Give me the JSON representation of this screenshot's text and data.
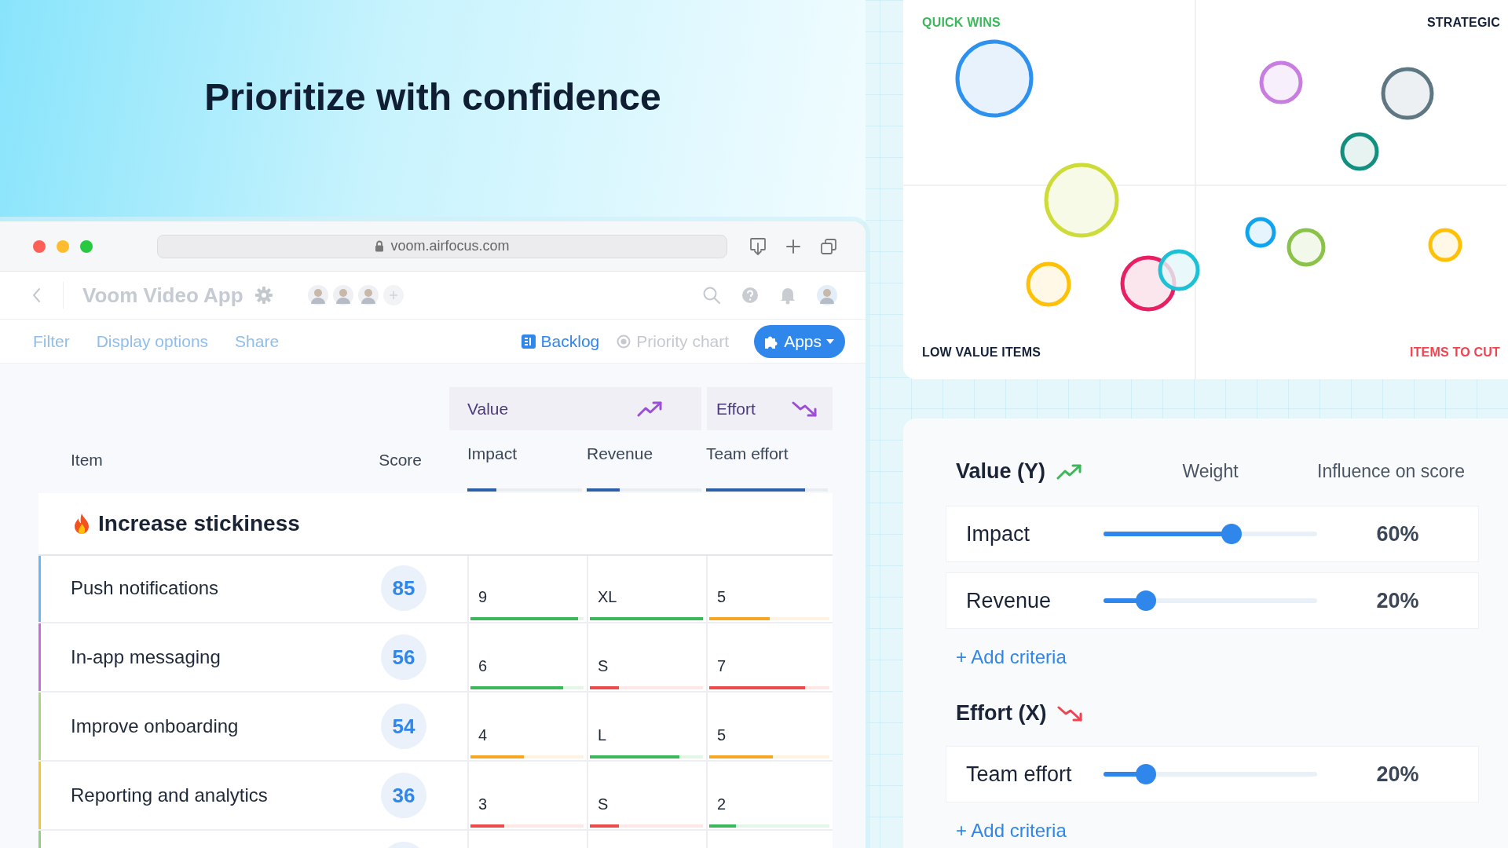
{
  "headline": "Prioritize with confidence",
  "browser": {
    "url": "voom.airfocus.com"
  },
  "app_header": {
    "title": "Voom Video App"
  },
  "toolbar": {
    "links": [
      "Filter",
      "Display options",
      "Share"
    ],
    "views": [
      {
        "label": "Backlog",
        "kind": "list",
        "selected": true
      },
      {
        "label": "Priority chart",
        "kind": "chart",
        "selected": false
      }
    ],
    "apps_button": "Apps"
  },
  "table": {
    "groups": [
      {
        "label": "Value",
        "kind": "up"
      },
      {
        "label": "Effort",
        "kind": "down"
      }
    ],
    "columns": [
      {
        "label": "Item"
      },
      {
        "label": "Score"
      },
      {
        "label": "Impact",
        "level": 0.25
      },
      {
        "label": "Revenue",
        "level": 0.29
      },
      {
        "label": "Team effort",
        "level": 0.81
      }
    ],
    "group_row": {
      "title": "Increase stickiness"
    },
    "rows": [
      {
        "item": "Push notifications",
        "score": "85",
        "color": "#6ab7f5",
        "cells": [
          {
            "value": "9",
            "level": 0.95,
            "color": "#3bb85a"
          },
          {
            "value": "XL",
            "level": 1,
            "color": "#3bb85a"
          },
          {
            "value": "5",
            "level": 0.5,
            "color": "#f5a623"
          }
        ]
      },
      {
        "item": "In-app messaging",
        "score": "56",
        "color": "#c66fe0",
        "cells": [
          {
            "value": "6",
            "level": 0.82,
            "color": "#3bb85a"
          },
          {
            "value": "S",
            "level": 0.26,
            "color": "#ee4a4a"
          },
          {
            "value": "7",
            "level": 0.8,
            "color": "#ee4a4a"
          }
        ]
      },
      {
        "item": "Improve onboarding",
        "score": "54",
        "color": "#a9d67a",
        "cells": [
          {
            "value": "4",
            "level": 0.47,
            "color": "#f5a623"
          },
          {
            "value": "L",
            "level": 0.79,
            "color": "#3bb85a"
          },
          {
            "value": "5",
            "level": 0.53,
            "color": "#f5a623"
          }
        ]
      },
      {
        "item": "Reporting and analytics",
        "score": "36",
        "color": "#f7c52c",
        "cells": [
          {
            "value": "3",
            "level": 0.3,
            "color": "#ee4a4a"
          },
          {
            "value": "S",
            "level": 0.26,
            "color": "#ee4a4a"
          },
          {
            "value": "2",
            "level": 0.22,
            "color": "#3bb85a"
          }
        ]
      },
      {
        "color": "#8fd17e"
      }
    ]
  },
  "priority_chart": {
    "quadrants": [
      {
        "label": "QUICK WINS",
        "color": "#3bb85a"
      },
      {
        "label": "STRATEGIC",
        "color": "#14213a"
      },
      {
        "label": "LOW VALUE ITEMS",
        "color": "#14213a"
      },
      {
        "label": "ITEMS TO CUT",
        "color": "#f0434f"
      }
    ]
  },
  "weights": {
    "columns": [
      "Weight",
      "Influence on score"
    ],
    "sections": [
      {
        "title": "Value (Y)",
        "kind": "up",
        "criteria": [
          {
            "name": "Impact",
            "level": 0.6,
            "reading": "60%"
          },
          {
            "name": "Revenue",
            "level": 0.2,
            "reading": "20%"
          }
        ],
        "add_link": "+ Add criteria"
      },
      {
        "title": "Effort (X)",
        "kind": "down",
        "criteria": [
          {
            "name": "Team effort",
            "level": 0.2,
            "reading": "20%"
          }
        ],
        "add_link": "+ Add criteria"
      }
    ]
  }
}
